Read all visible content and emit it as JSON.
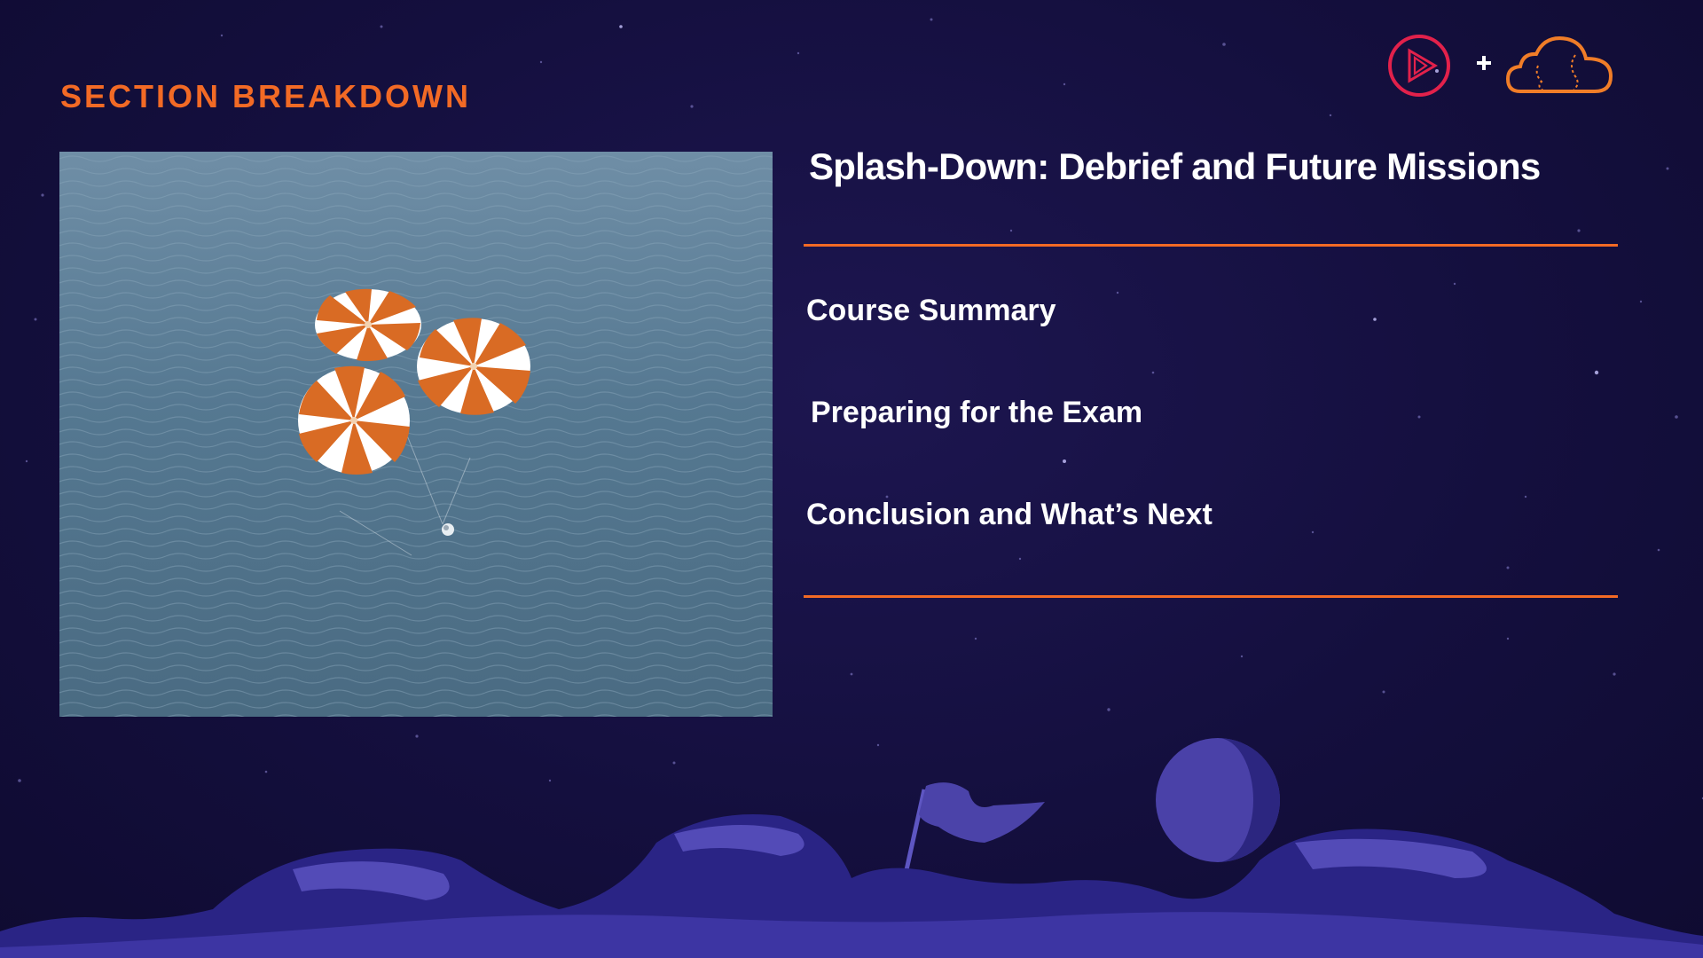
{
  "slide": {
    "section_label": "SECTION BREAKDOWN",
    "module_title": "Splash-Down: Debrief and Future Missions",
    "topics": [
      "Course Summary",
      "Preparing for the Exam",
      "Conclusion and What’s Next"
    ]
  },
  "logos": {
    "pluralsight": "play-triangle-logo-icon",
    "plus_sign": "+",
    "acloudguru": "cloud-logo-icon"
  },
  "image": {
    "subject": "three-orange-white-parachutes-over-ocean",
    "icon": "parachute-landing-image"
  },
  "colors": {
    "accent": "#f26a25",
    "background": "#140f3e",
    "text": "#ffffff",
    "logo_red": "#e2214b",
    "ocean": "#5b7d95"
  }
}
